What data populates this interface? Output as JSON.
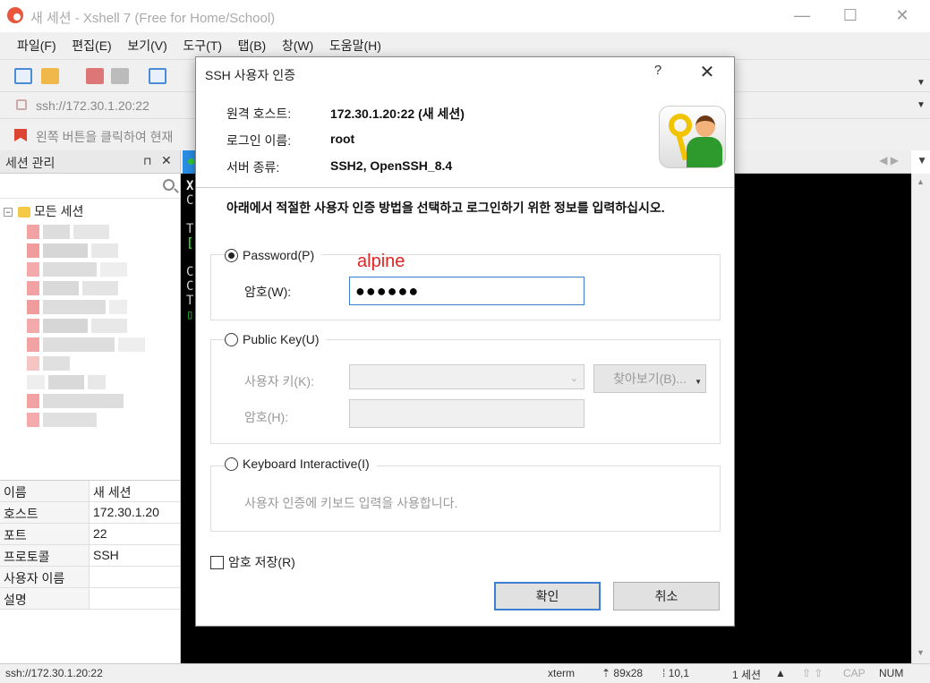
{
  "window": {
    "title": "새 세션 - Xshell 7 (Free for Home/School)",
    "minimize": "—",
    "maximize": "☐",
    "close": "✕"
  },
  "menu": [
    "파일(F)",
    "편집(E)",
    "보기(V)",
    "도구(T)",
    "탭(B)",
    "창(W)",
    "도움말(H)"
  ],
  "address": "ssh://172.30.1.20:22",
  "hint": "왼쪽 버튼을 클릭하여 현재",
  "session_pane": {
    "title": "세션 관리",
    "pin": "⊓",
    "close": "✕",
    "root_expander": "−",
    "root_label": "모든 세션",
    "properties": [
      {
        "key": "이름",
        "value": "새 세션"
      },
      {
        "key": "호스트",
        "value": "172.30.1.20"
      },
      {
        "key": "포트",
        "value": "22"
      },
      {
        "key": "프로토콜",
        "value": "SSH"
      },
      {
        "key": "사용자 이름",
        "value": ""
      },
      {
        "key": "설명",
        "value": ""
      }
    ]
  },
  "terminal": {
    "lines": [
      "X",
      "C",
      "",
      "T",
      "[",
      "",
      "C",
      "C",
      "T",
      "▯"
    ]
  },
  "status": {
    "address": "ssh://172.30.1.20:22",
    "term": "xterm",
    "size": "89x28",
    "cursor": "10,1",
    "sessions": "1 세션",
    "cap": "CAP",
    "num": "NUM"
  },
  "dialog": {
    "title": "SSH 사용자 인증",
    "help": "?",
    "close": "✕",
    "info": [
      {
        "key": "원격 호스트:",
        "value": "172.30.1.20:22 (새 세션)"
      },
      {
        "key": "로그인 이름:",
        "value": "root"
      },
      {
        "key": "서버 종류:",
        "value": "SSH2, OpenSSH_8.4"
      }
    ],
    "instruction": "아래에서 적절한 사용자 인증 방법을 선택하고 로그인하기 위한 정보를 입력하십시오.",
    "password_method": {
      "label": "Password(P)",
      "selected": true,
      "field_label": "암호(W):",
      "value": "●●●●●●",
      "annotation": "alpine"
    },
    "pubkey_method": {
      "label": "Public Key(U)",
      "selected": false,
      "user_key_label": "사용자 키(K):",
      "browse_label": "찾아보기(B)...",
      "passphrase_label": "암호(H):"
    },
    "keyboard_method": {
      "label": "Keyboard Interactive(I)",
      "selected": false,
      "description": "사용자 인증에 키보드 입력을 사용합니다."
    },
    "save_password_label": "암호 저장(R)",
    "ok_label": "확인",
    "cancel_label": "취소"
  }
}
